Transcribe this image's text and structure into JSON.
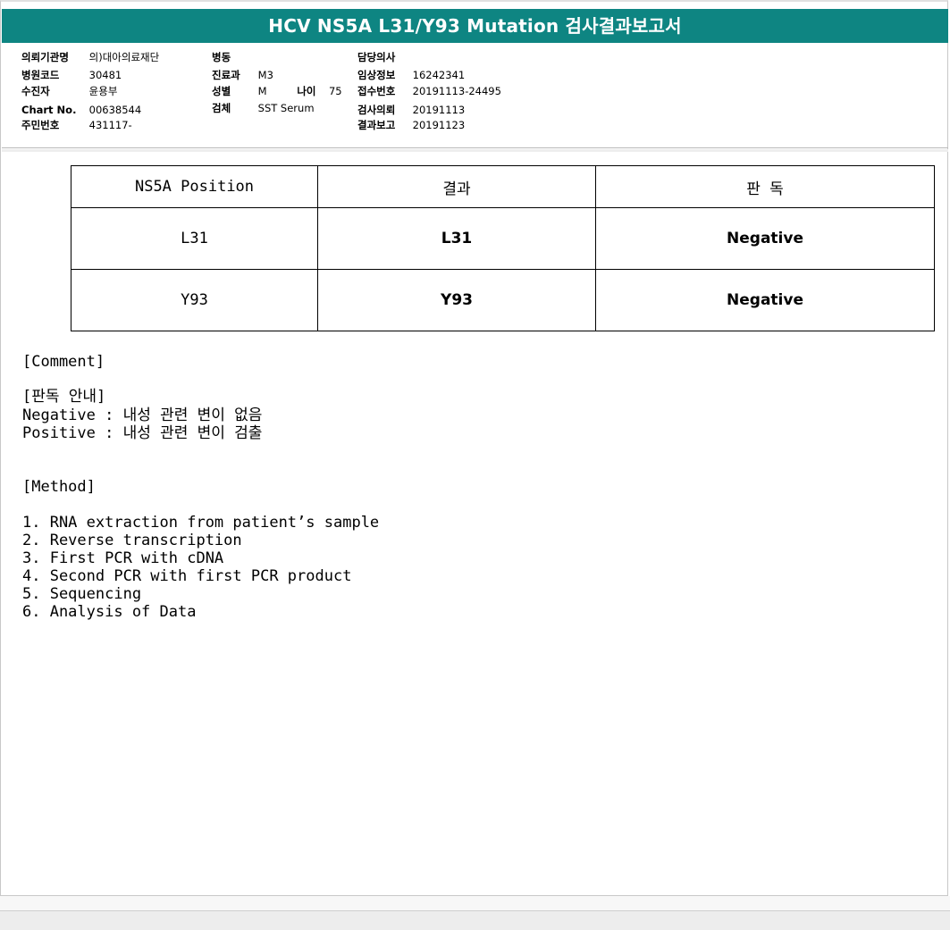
{
  "report": {
    "title": "HCV NS5A L31/Y93 Mutation 검사결과보고서"
  },
  "patient": {
    "institution_label": "의뢰기관명",
    "institution_value": "의)대아의료재단",
    "hospital_code_label": "병원코드",
    "hospital_code_value": "30481",
    "examinee_label": "수진자",
    "examinee_value": "윤용부",
    "chart_label": "Chart No.",
    "chart_value": "00638544",
    "resident_label": "주민번호",
    "resident_value": "431117-",
    "ward_label": "병동",
    "ward_value": "",
    "department_label": "진료과",
    "department_value": "M3",
    "sex_label": "성별",
    "sex_value": "M",
    "age_label": "나이",
    "age_value": "75",
    "specimen_label": "검체",
    "specimen_value": "SST Serum",
    "doctor_label": "담당의사",
    "doctor_value": "",
    "clinical_label": "임상정보",
    "clinical_value": "16242341",
    "receipt_label": "접수번호",
    "receipt_value": "20191113-24495",
    "request_label": "검사의뢰",
    "request_value": "20191113",
    "reported_label": "결과보고",
    "reported_value": "20191123"
  },
  "results": {
    "headers": [
      "NS5A Position",
      "결과",
      "판 독"
    ],
    "rows": [
      {
        "position": "L31",
        "result": "L31",
        "interpretation": "Negative"
      },
      {
        "position": "Y93",
        "result": "Y93",
        "interpretation": "Negative"
      }
    ]
  },
  "comment": {
    "heading": "[Comment]",
    "guide_heading": "[판독 안내]",
    "negative_line": "Negative : 내성 관련 변이 없음",
    "positive_line": "Positive : 내성 관련 변이 검출"
  },
  "method": {
    "heading": "[Method]",
    "steps": [
      "1. RNA extraction from patient’s sample",
      "2. Reverse transcription",
      "3. First PCR with cDNA",
      "4. Second PCR with first PCR product",
      "5. Sequencing",
      "6. Analysis of Data"
    ]
  }
}
